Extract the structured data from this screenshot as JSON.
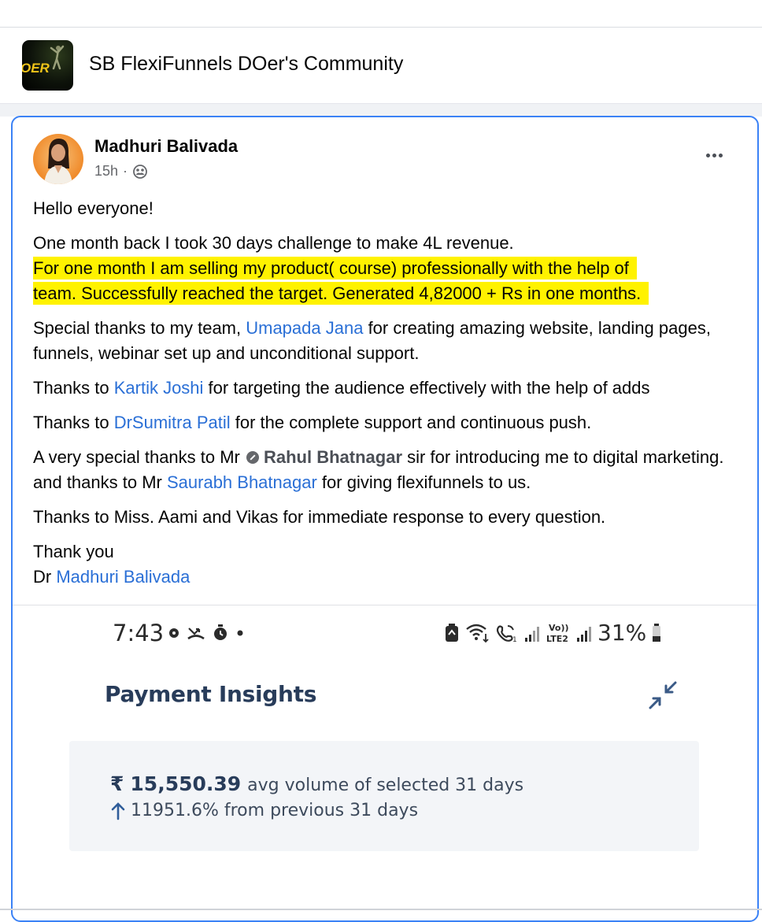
{
  "group": {
    "name": "SB FlexiFunnels DOer's Community",
    "logo_text": "OER"
  },
  "post": {
    "author": "Madhuri Balivada",
    "time": "15h",
    "audience_icon": "group-members-icon",
    "more_icon": "more-options-icon",
    "greeting": "Hello everyone!",
    "intro": "One month back I took 30 days challenge to make 4L revenue.",
    "highlight_line1": "For one month I am selling my product( course) professionally with the help of",
    "highlight_line2": "team.  Successfully reached the target. Generated 4,82000 + Rs in one months.",
    "highlight_color": "#fff200",
    "link_color": "#2a6fd6",
    "thanks_team_pre": "Special thanks to my team, ",
    "thanks_team_name": "Umapada Jana",
    "thanks_team_post": " for creating amazing website, landing pages, funnels, webinar set up and unconditional support.",
    "thanks2_pre": "Thanks to ",
    "thanks2_name": "Kartik Joshi",
    "thanks2_post": " for targeting the audience effectively with the help of adds",
    "thanks3_pre": "Thanks to ",
    "thanks3_name": "DrSumitra Patil",
    "thanks3_post": " for the complete support and continuous push.",
    "thanks4_pre": "A very special thanks to Mr ",
    "thanks4_name": "Rahul Bhatnagar",
    "thanks4_mid": " sir for introducing me to digital marketing. and thanks to Mr ",
    "thanks4_name2": "Saurabh Bhatnagar",
    "thanks4_post": " for giving flexifunnels to us.",
    "thanks5": "Thanks to Miss. Aami and  Vikas for immediate response to every question.",
    "signoff": "Thank you",
    "sign_prefix": "Dr ",
    "sign_name": "Madhuri Balivada"
  },
  "screenshot": {
    "time": "7:43",
    "battery": "31%",
    "title": "Payment Insights",
    "currency_symbol": "₹",
    "amount": "15,550.39",
    "amount_desc": "avg volume of selected 31 days",
    "change": "11951.6% from previous 31 days",
    "title_color": "#283c5a",
    "box_color": "#f3f5f8"
  }
}
